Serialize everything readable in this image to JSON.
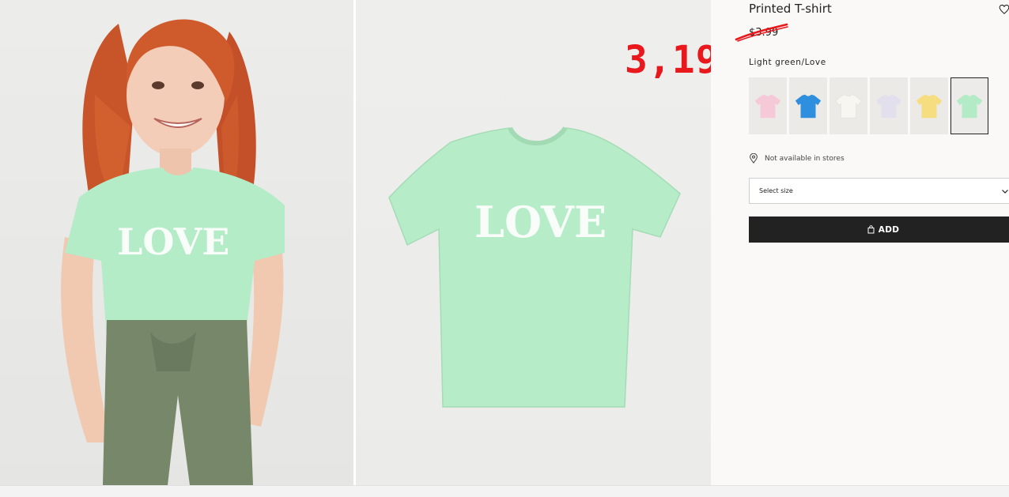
{
  "product": {
    "title": "Printed T-shirt",
    "old_price": "$3.99",
    "sale_price_annotation": "3,19",
    "color_name": "Light green/Love",
    "availability": "Not available in stores"
  },
  "gallery": {
    "main_image": "girl-wearing-green-love-tshirt",
    "product_image": "green-love-tshirt-flatlay",
    "shirt_print": "LOVE"
  },
  "swatches": [
    {
      "name": "pink",
      "color": "#f6c9d8",
      "selected": false
    },
    {
      "name": "blue",
      "color": "#2f8fdf",
      "selected": false
    },
    {
      "name": "white",
      "color": "#f7f6f1",
      "selected": false
    },
    {
      "name": "lilac",
      "color": "#e3e0ee",
      "selected": false
    },
    {
      "name": "yellow",
      "color": "#f6dd80",
      "selected": false
    },
    {
      "name": "light-green",
      "color": "#b2ebc5",
      "selected": true
    }
  ],
  "size_select": {
    "label": "Select size"
  },
  "add_button": {
    "label": "ADD"
  },
  "colors": {
    "shirt_green": "#b3ecc6",
    "sale_red": "#e8181c",
    "button_dark": "#222222",
    "panel_bg": "#faf9f8"
  },
  "icons": {
    "favorite": "heart-outline-icon",
    "location": "location-pin-icon",
    "dropdown": "chevron-down-icon",
    "bag": "shopping-bag-icon"
  }
}
